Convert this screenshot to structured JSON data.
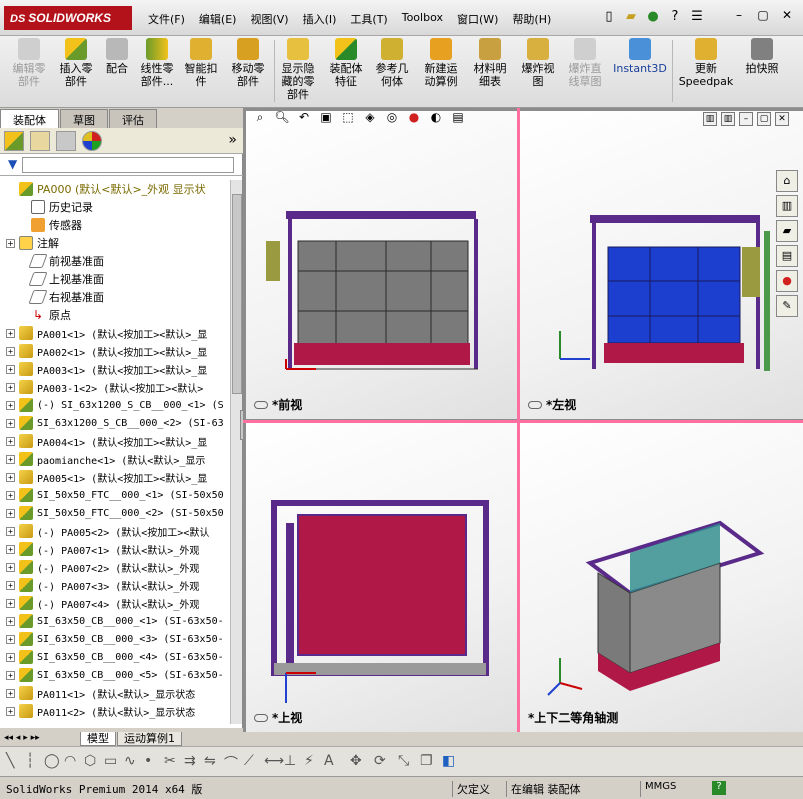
{
  "app": {
    "logo_prefix": "DS",
    "logo_text": "SOLIDWORKS"
  },
  "menu": [
    "文件(F)",
    "编辑(E)",
    "视图(V)",
    "插入(I)",
    "工具(T)",
    "Toolbox",
    "窗口(W)",
    "帮助(H)"
  ],
  "ribbon": [
    {
      "label": "编辑零\n部件",
      "disabled": true
    },
    {
      "label": "插入零\n部件",
      "disabled": false
    },
    {
      "label": "配合",
      "disabled": false
    },
    {
      "label": "线性零\n部件...",
      "disabled": false
    },
    {
      "label": "智能扣\n件",
      "disabled": false
    },
    {
      "label": "移动零\n部件",
      "disabled": false
    },
    {
      "label": "显示隐\n藏的零\n部件",
      "disabled": false
    },
    {
      "label": "装配体\n特征",
      "disabled": false
    },
    {
      "label": "参考几\n何体",
      "disabled": false
    },
    {
      "label": "新建运\n动算例",
      "disabled": false
    },
    {
      "label": "材料明\n细表",
      "disabled": false
    },
    {
      "label": "爆炸视\n图",
      "disabled": false
    },
    {
      "label": "爆炸直\n线草图",
      "disabled": true
    },
    {
      "label": "Instant3D",
      "disabled": false
    },
    {
      "label": "更新\nSpeedpak",
      "disabled": false
    },
    {
      "label": "拍快照",
      "disabled": false
    }
  ],
  "left_tabs": [
    "装配体",
    "草图",
    "评估"
  ],
  "tree": {
    "root": "PA000  (默认<默认>_外观 显示状",
    "features": [
      "历史记录",
      "传感器",
      "注解",
      "前视基准面",
      "上视基准面",
      "右视基准面",
      "原点"
    ],
    "components": [
      "PA001<1> (默认<按加工><默认>_显",
      "PA002<1> (默认<按加工><默认>_显",
      "PA003<1> (默认<按加工><默认>_显",
      "PA003-1<2> (默认<按加工><默认>",
      "(-) SI_63x1200_S_CB__000_<1> (S",
      "SI_63x1200_S_CB__000_<2> (SI-63",
      "PA004<1> (默认<按加工><默认>_显",
      "paomianche<1> (默认<默认>_显示",
      "PA005<1> (默认<按加工><默认>_显",
      "SI_50x50_FTC__000_<1> (SI-50x50",
      "SI_50x50_FTC__000_<2> (SI-50x50",
      "(-) PA005<2> (默认<按加工><默认",
      "(-) PA007<1> (默认<默认>_外观",
      "(-) PA007<2> (默认<默认>_外观",
      "(-) PA007<3> (默认<默认>_外观",
      "(-) PA007<4> (默认<默认>_外观",
      "SI_63x50_CB__000_<1> (SI-63x50-",
      "SI_63x50_CB__000_<3> (SI-63x50-",
      "SI_63x50_CB__000_<4> (SI-63x50-",
      "SI_63x50_CB__000_<5> (SI-63x50-",
      "PA011<1> (默认<默认>_显示状态",
      "PA011<2> (默认<默认>_显示状态"
    ]
  },
  "viewports": [
    "*前视",
    "*左视",
    "*上视",
    "*上下二等角轴测"
  ],
  "bottom_tabs": [
    "模型",
    "运动算例1"
  ],
  "status": {
    "product": "SolidWorks Premium 2014 x64 版",
    "state": "欠定义",
    "mode": "在编辑 装配体",
    "units": "MMGS"
  },
  "colors": {
    "frame": "#5a2a8a",
    "panel_gray": "#7a7a7a",
    "panel_blue": "#1c3fd0",
    "base_red": "#b01848",
    "accent_pink": "#ff6fa2"
  }
}
